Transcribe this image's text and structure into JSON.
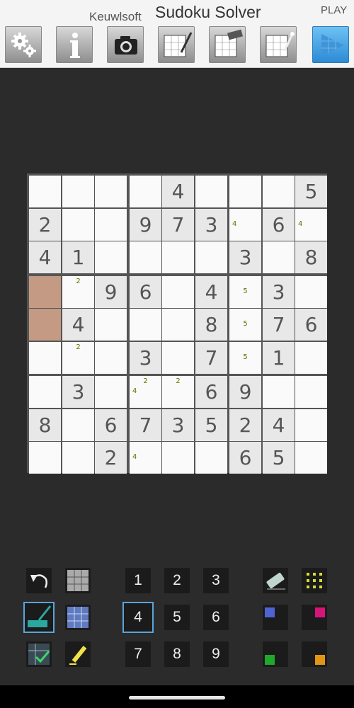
{
  "header": {
    "brand": "Keuwlsoft",
    "title": "Sudoku Solver",
    "play_label": "PLAY",
    "buttons": [
      {
        "name": "settings-button",
        "icon": "gears-icon"
      },
      {
        "name": "info-button",
        "icon": "info-icon"
      },
      {
        "name": "camera-button",
        "icon": "camera-icon"
      },
      {
        "name": "edit-grid-button",
        "icon": "grid-pencil-icon"
      },
      {
        "name": "clear-grid-button",
        "icon": "grid-eraser-icon"
      },
      {
        "name": "solve-grid-button",
        "icon": "grid-wand-icon"
      },
      {
        "name": "play-button",
        "icon": "play-icon"
      }
    ]
  },
  "board": {
    "cells": [
      [
        "",
        "",
        "",
        "",
        "4",
        "",
        "",
        "",
        "5"
      ],
      [
        "2",
        "",
        "",
        "9",
        "7",
        "3",
        "",
        "6",
        ""
      ],
      [
        "4",
        "1",
        "",
        "",
        "",
        "",
        "3",
        "",
        "8"
      ],
      [
        "",
        "",
        "9",
        "6",
        "",
        "4",
        "",
        "3",
        ""
      ],
      [
        "",
        "4",
        "",
        "",
        "",
        "8",
        "",
        "7",
        "6"
      ],
      [
        "",
        "",
        "",
        "3",
        "",
        "7",
        "",
        "1",
        ""
      ],
      [
        "",
        "3",
        "",
        "",
        "",
        "6",
        "9",
        "",
        ""
      ],
      [
        "8",
        "",
        "6",
        "7",
        "3",
        "5",
        "2",
        "4",
        ""
      ],
      [
        "",
        "",
        "2",
        "",
        "",
        "",
        "6",
        "5",
        ""
      ]
    ],
    "given": [
      [
        false,
        false,
        false,
        false,
        true,
        false,
        false,
        false,
        true
      ],
      [
        true,
        false,
        false,
        true,
        true,
        true,
        false,
        true,
        false
      ],
      [
        true,
        true,
        false,
        false,
        false,
        false,
        true,
        false,
        true
      ],
      [
        false,
        false,
        true,
        true,
        false,
        true,
        false,
        true,
        false
      ],
      [
        false,
        true,
        false,
        false,
        false,
        true,
        false,
        true,
        true
      ],
      [
        false,
        false,
        false,
        true,
        false,
        true,
        false,
        true,
        false
      ],
      [
        false,
        true,
        false,
        false,
        false,
        true,
        true,
        false,
        false
      ],
      [
        true,
        false,
        true,
        true,
        true,
        true,
        true,
        true,
        false
      ],
      [
        false,
        false,
        true,
        false,
        false,
        false,
        true,
        true,
        false
      ]
    ],
    "candidates": [
      {
        "row": 1,
        "col": 6,
        "text": "4",
        "pos": "left"
      },
      {
        "row": 1,
        "col": 8,
        "text": "4",
        "pos": "left"
      },
      {
        "row": 3,
        "col": 1,
        "text": "2",
        "pos": "top"
      },
      {
        "row": 3,
        "col": 6,
        "text": "5",
        "pos": "mid"
      },
      {
        "row": 4,
        "col": 6,
        "text": "5",
        "pos": "mid"
      },
      {
        "row": 5,
        "col": 1,
        "text": "2",
        "pos": "top"
      },
      {
        "row": 5,
        "col": 6,
        "text": "5",
        "pos": "mid"
      },
      {
        "row": 6,
        "col": 3,
        "text": "4",
        "pos": "left"
      },
      {
        "row": 6,
        "col": 3,
        "text": "2",
        "pos": "top"
      },
      {
        "row": 6,
        "col": 4,
        "text": "2",
        "pos": "top"
      },
      {
        "row": 8,
        "col": 3,
        "text": "4",
        "pos": "left"
      }
    ],
    "highlighted": [
      {
        "row": 3,
        "col": 0
      },
      {
        "row": 4,
        "col": 0
      }
    ],
    "highlight_color": "#c49a84"
  },
  "keypad": {
    "digits": [
      "1",
      "2",
      "3",
      "4",
      "5",
      "6",
      "7",
      "8",
      "9"
    ],
    "selected_digit": "4"
  },
  "tools": [
    {
      "name": "undo-button",
      "icon": "undo-icon"
    },
    {
      "name": "grid-view-button",
      "icon": "grid-thumb-icon"
    },
    {
      "name": "sweep-tool-button",
      "icon": "broom-icon",
      "active": true
    },
    {
      "name": "grid-view-blue-button",
      "icon": "grid-blue-icon"
    },
    {
      "name": "check-grid-button",
      "icon": "grid-check-icon"
    },
    {
      "name": "highlighter-button",
      "icon": "highlighter-icon"
    },
    {
      "name": "eraser-button",
      "icon": "eraser-icon"
    },
    {
      "name": "candidates-button",
      "icon": "dots-grid-icon"
    }
  ],
  "colors": {
    "swatch_blue": "#4f63d2",
    "swatch_magenta": "#d6147c",
    "swatch_green": "#1ea82c",
    "swatch_orange": "#e29512",
    "accent": "#5aa4d8"
  }
}
